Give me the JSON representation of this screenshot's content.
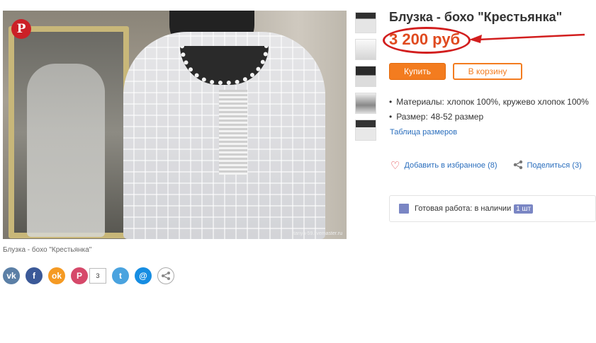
{
  "product": {
    "title": "Блузка - бохо \"Крестьянка\"",
    "price": "3 200 руб",
    "caption": "Блузка - бохо \"Крестьянка\"",
    "watermark": "tanya-59.livemaster.ru"
  },
  "buttons": {
    "buy": "Купить",
    "cart": "В корзину"
  },
  "specs": [
    {
      "key": "Материалы:",
      "value": "хлопок 100%, кружево хлопок 100%"
    },
    {
      "key": "Размер:",
      "value": "48-52 размер"
    }
  ],
  "links": {
    "size_table": "Таблица размеров",
    "favorite": "Добавить в избранное (8)",
    "share": "Поделиться (3)"
  },
  "stock": {
    "label": "Готовая работа: в наличии",
    "qty": "1 шт"
  },
  "share_bar": {
    "pinterest_count": "3",
    "icons": [
      "vk-icon",
      "facebook-icon",
      "odnoklassniki-icon",
      "pinterest-icon",
      "twitter-icon",
      "mail-icon",
      "share-icon"
    ]
  },
  "colors": {
    "accent_orange": "#f37c1f",
    "price_red": "#e04a1f",
    "annotation_red": "#d21e1e",
    "link_blue": "#2a6ebd"
  }
}
